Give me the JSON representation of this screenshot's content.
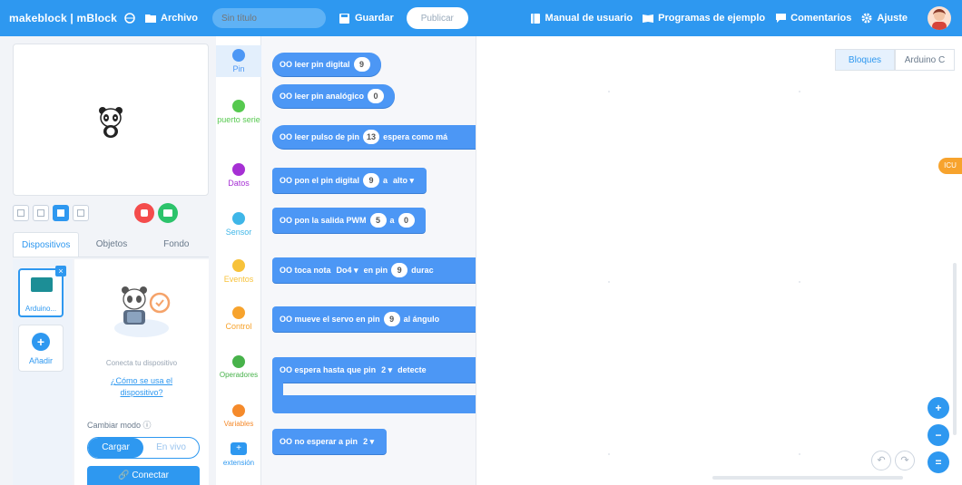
{
  "topbar": {
    "brand": "makeblock | mBlock",
    "file_label": "Archivo",
    "title_placeholder": "Sin título",
    "save_label": "Guardar",
    "publish_label": "Publicar",
    "manual_label": "Manual de usuario",
    "examples_label": "Programas de ejemplo",
    "feedback_label": "Comentarios",
    "settings_label": "Ajuste"
  },
  "stage_panel": {
    "tabs": [
      "Dispositivos",
      "Objetos",
      "Fondo"
    ],
    "active_tab": "Dispositivos",
    "device_label": "Arduino...",
    "add_label": "Añadir",
    "connect_hint": "Conecta tu dispositivo",
    "help_link_line1": "¿Cómo se usa el",
    "help_link_line2": "dispositivo?",
    "mode_label": "Cambiar modo ⓘ",
    "mode_upload": "Cargar",
    "mode_live": "En vivo",
    "connect_button": "🔗 Conectar"
  },
  "categories": [
    {
      "label": "Pin",
      "color": "#4c97f5"
    },
    {
      "label": "puerto serie",
      "color": "#56c94f"
    },
    {
      "label": "Datos",
      "color": "#a630d4"
    },
    {
      "label": "Sensor",
      "color": "#3fb6e8"
    },
    {
      "label": "Eventos",
      "color": "#f7c23a"
    },
    {
      "label": "Control",
      "color": "#f7a32d"
    },
    {
      "label": "Operadores",
      "color": "#47b24a"
    },
    {
      "label": "Variables",
      "color": "#f58a2b"
    },
    {
      "label": "extensión",
      "color": "#2e98f0"
    }
  ],
  "blocks": {
    "b1_text": "leer pin digital",
    "b1_val": "9",
    "b2_text": "leer pin analógico",
    "b2_val": "0",
    "b3_text": "leer pulso de pin",
    "b3_val": "13",
    "b3_tail": "espera como má",
    "b4_text": "pon el pin digital",
    "b4_val": "9",
    "b4_mid": "a",
    "b4_dd": "alto ▾",
    "b5_text": "pon la salida PWM",
    "b5_val": "5",
    "b5_mid": "a",
    "b5_val2": "0",
    "b6_text": "toca nota",
    "b6_dd": "Do4 ▾",
    "b6_mid": "en pin",
    "b6_val": "9",
    "b6_tail": "durac",
    "b7_text": "mueve el servo en pin",
    "b7_val": "9",
    "b7_tail": "al ángulo",
    "b8_text": "espera hasta que pin",
    "b8_dd": "2 ▾",
    "b8_tail": "detecte",
    "b9_text": "no esperar a pin",
    "b9_dd": "2 ▾",
    "prefix": "OO"
  },
  "script_area": {
    "tabs": [
      "Bloques",
      "Arduino C"
    ],
    "active_tab": "Bloques",
    "side_badge": "ICU"
  }
}
